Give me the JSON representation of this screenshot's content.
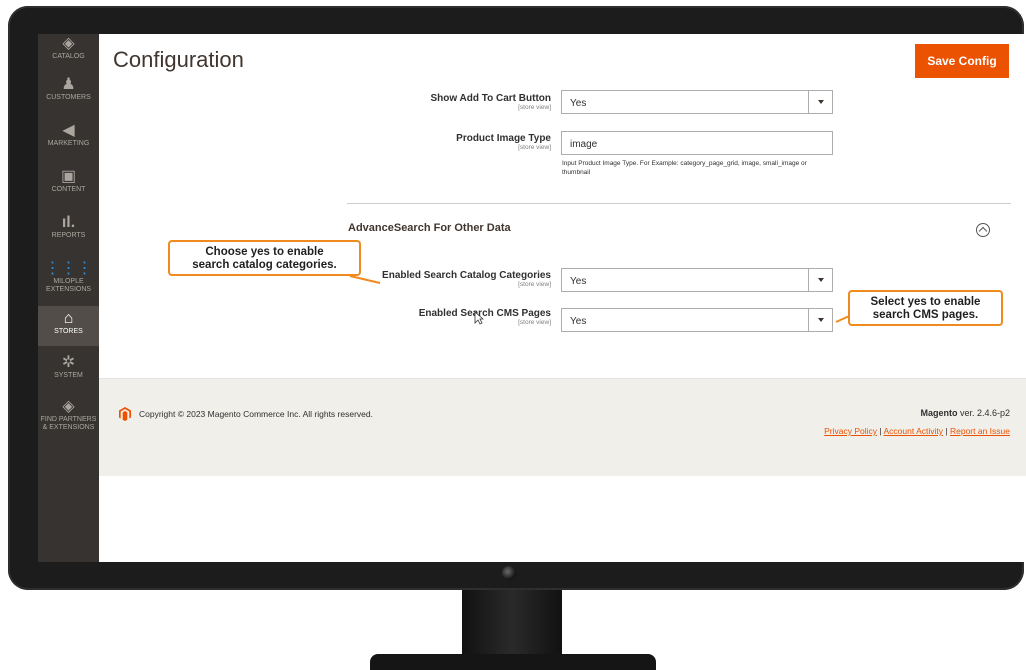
{
  "colors": {
    "accent": "#eb5202",
    "sidebar_bg": "#373330",
    "callout_border": "#f08a1e"
  },
  "sidebar": {
    "items": [
      {
        "label": "CATALOG",
        "icon": "cube-icon"
      },
      {
        "label": "CUSTOMERS",
        "icon": "person-icon"
      },
      {
        "label": "MARKETING",
        "icon": "megaphone-icon"
      },
      {
        "label": "CONTENT",
        "icon": "layout-icon"
      },
      {
        "label": "REPORTS",
        "icon": "bar-chart-icon"
      },
      {
        "label": "MILOPLE",
        "label2": "EXTENSIONS",
        "icon": "grid-icon"
      },
      {
        "label": "STORES",
        "icon": "store-icon"
      },
      {
        "label": "SYSTEM",
        "icon": "gear-icon"
      },
      {
        "label": "FIND PARTNERS",
        "label2": "& EXTENSIONS",
        "icon": "cube-icon"
      }
    ]
  },
  "header": {
    "title": "Configuration",
    "save_label": "Save Config"
  },
  "fields": {
    "add_to_cart": {
      "label": "Show Add To Cart Button",
      "scope": "[store view]",
      "value": "Yes"
    },
    "image_type": {
      "label": "Product Image Type",
      "scope": "[store view]",
      "value": "image",
      "note": "Input Product Image Type. For Example: category_page_grid, image, small_image or thumbnail"
    },
    "search_categories": {
      "label": "Enabled Search Catalog Categories",
      "scope": "[store view]",
      "value": "Yes"
    },
    "search_cms": {
      "label": "Enabled Search CMS Pages",
      "scope": "[store view]",
      "value": "Yes"
    }
  },
  "section": {
    "title": "AdvanceSearch For Other Data"
  },
  "callouts": {
    "categories": {
      "line1": "Choose yes to enable",
      "line2": "search catalog categories."
    },
    "cms": {
      "line1": "Select yes to enable",
      "line2": "search CMS pages."
    }
  },
  "footer": {
    "copyright": "Copyright © 2023 Magento Commerce Inc. All rights reserved.",
    "brand": "Magento",
    "version": " ver. 2.4.6-p2",
    "links": [
      "Privacy Policy",
      "Account Activity",
      "Report an Issue"
    ],
    "sep": " | "
  }
}
